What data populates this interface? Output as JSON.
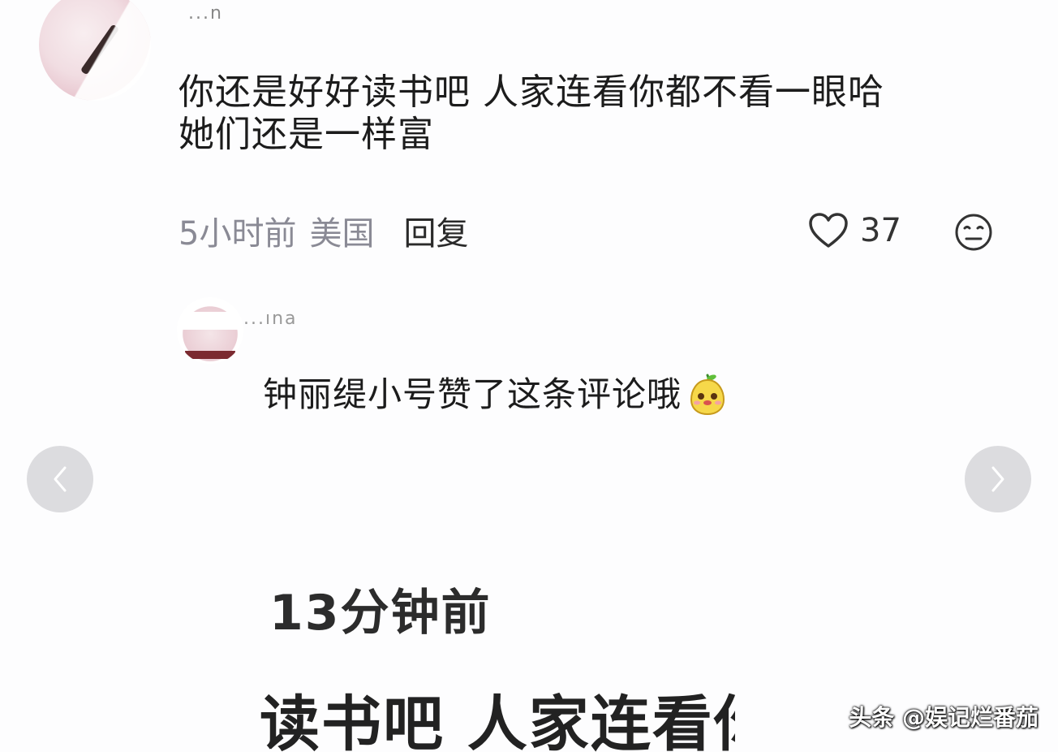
{
  "comment_1": {
    "username": "...n",
    "lines": [
      "你还是好好读书吧 人家连看你都不看一眼哈",
      "她们还是一样富"
    ],
    "time": "5小时前",
    "location": "美国",
    "reply_label": "回复",
    "like_count": "37",
    "icons": {
      "like": "heart-icon",
      "dislike": "neutral-face-icon"
    }
  },
  "comment_2": {
    "username": "...ına",
    "text": "钟丽缇小号赞了这条评论哦",
    "emoji": "pear-face-emoji"
  },
  "navigation": {
    "prev_icon": "chevron-left-icon",
    "next_icon": "chevron-right-icon"
  },
  "zoomed_crop": {
    "time": "13分钟前",
    "text": "读书吧 人家连看你"
  },
  "watermark": {
    "text": "头条 @娱记烂番茄"
  },
  "colors": {
    "meta_grey": "#8a8a95",
    "nav_button_bg": "#dcdcdf",
    "background": "#fdfdfe"
  }
}
